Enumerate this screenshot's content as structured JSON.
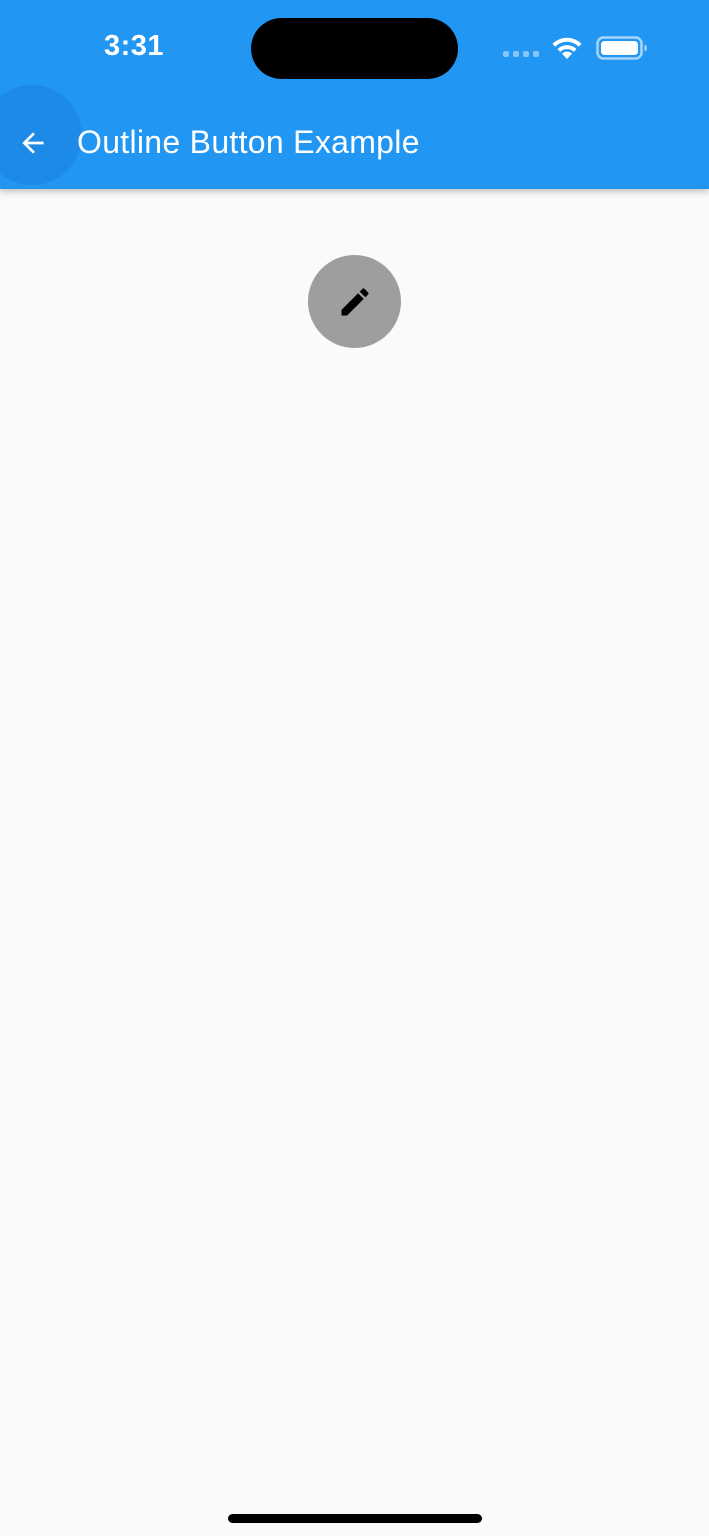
{
  "status_bar": {
    "time": "3:31",
    "icons": [
      "cellular-signal-icon",
      "wifi-icon",
      "battery-icon"
    ]
  },
  "app_bar": {
    "title": "Outline Button Example",
    "back_icon": "arrow-back-icon",
    "background_color": "#2196f3"
  },
  "main": {
    "edit_button_icon": "edit-pencil-icon",
    "edit_button_color": "#9e9e9e"
  },
  "colors": {
    "background": "#fafafa",
    "accent": "#2196f3",
    "ripple": "#1e88e5"
  }
}
